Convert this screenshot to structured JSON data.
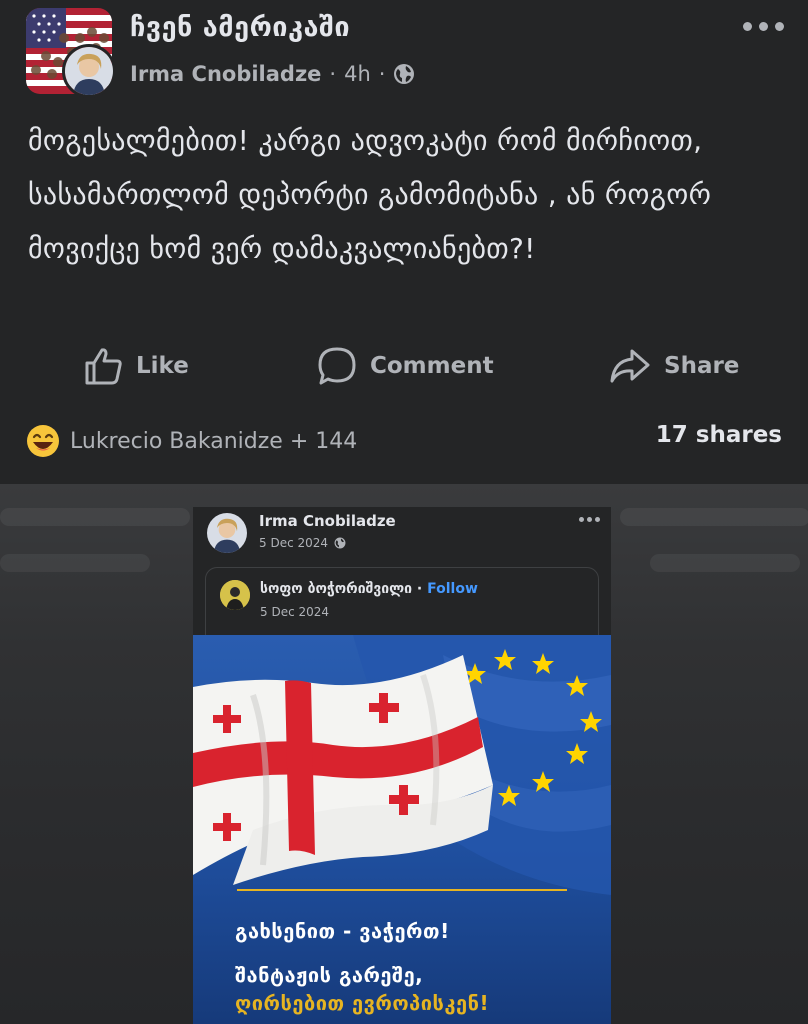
{
  "post": {
    "group_name": "ჩვენ ამერიკაში",
    "author": "Irma Cnobiladze",
    "separator": "·",
    "time": "4h",
    "text": "მოგესალმებით!  კარგი ადვოკატი რომ მირჩიოთ,  სასამართლომ დეპორტი გამომიტანა , ან როგორ მოვიქცე ხომ ვერ დამაკვალიანებთ?!"
  },
  "actions": {
    "like": "Like",
    "comment": "Comment",
    "share": "Share"
  },
  "footer": {
    "reactions_text": "Lukrecio Bakanidze + 144",
    "shares_text": "17 shares"
  },
  "embedded": {
    "author": "Irma Cnobiladze",
    "date": "5 Dec 2024",
    "shared": {
      "name": "სოფო ბოჭორიშვილი",
      "separator": "·",
      "follow": "Follow",
      "date": "5 Dec 2024"
    },
    "banner": {
      "line1": "გახსენით - ვაჭერთ!",
      "line2": "შანტაჟის გარეშე,",
      "line3": "ღირსებით ევროპისკენ!"
    }
  },
  "colors": {
    "background": "#242526",
    "text_primary": "#e4e6eb",
    "text_secondary": "#b0b3b8",
    "link_blue": "#4599ff",
    "eu_blue": "#1e4c97",
    "gold": "#e6b422",
    "flag_red": "#d9232e"
  },
  "icons": {
    "more": "more-dots-icon",
    "privacy": "globe-icon",
    "like": "thumbs-up-icon",
    "comment": "comment-bubble-icon",
    "share": "share-arrow-icon",
    "reaction": "laughing-emoji-icon"
  }
}
